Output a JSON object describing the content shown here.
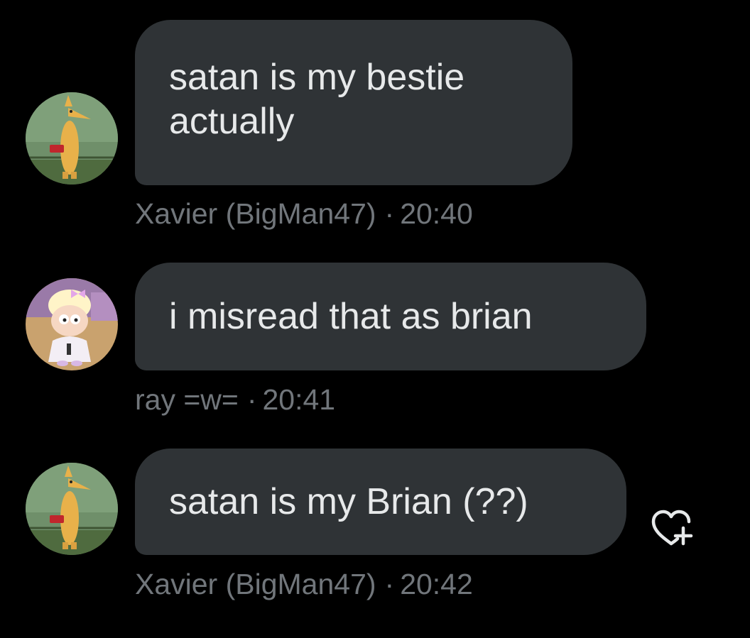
{
  "messages": [
    {
      "text_lines": [
        "satan is my bestie",
        "actually"
      ],
      "sender": "Xavier (BigMan47)",
      "time": "20:40",
      "avatar_icon": "fox-avatar"
    },
    {
      "text": "i misread that as brian",
      "sender": "ray =w=",
      "time": "20:41",
      "avatar_icon": "cartoon-avatar"
    },
    {
      "text": "satan is my Brian (??)",
      "sender": "Xavier (BigMan47)",
      "time": "20:42",
      "avatar_icon": "fox-avatar"
    }
  ],
  "separator": "·",
  "reaction_icon": "add-reaction-heart-icon",
  "colors": {
    "background": "#000000",
    "bubble": "#2f3336",
    "text": "#e7e9ea",
    "meta": "#71767b"
  }
}
